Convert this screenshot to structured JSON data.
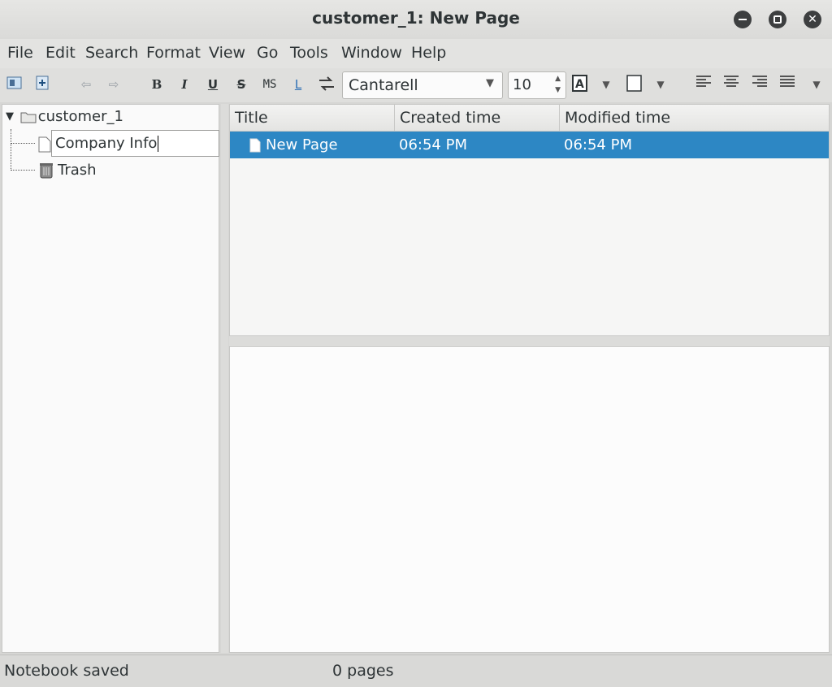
{
  "window": {
    "title": "customer_1: New Page"
  },
  "menubar": {
    "items": [
      "File",
      "Edit",
      "Search",
      "Format",
      "View",
      "Go",
      "Tools",
      "Window",
      "Help"
    ]
  },
  "toolbar": {
    "bold": "B",
    "italic": "I",
    "underline": "U",
    "strike": "S",
    "mono": "MS",
    "link": "L",
    "font_family": "Cantarell",
    "font_size": "10"
  },
  "tree": {
    "notebook": "customer_1",
    "editing_page": "Company Info",
    "trash": "Trash"
  },
  "page_list": {
    "columns": [
      "Title",
      "Created time",
      "Modified time"
    ],
    "rows": [
      {
        "title": "New Page",
        "created": "06:54 PM",
        "modified": "06:54 PM"
      }
    ]
  },
  "status": {
    "left": "Notebook saved",
    "pages": "0 pages"
  },
  "colors": {
    "selection": "#2d87c4",
    "window_bg": "#d6d6d4"
  }
}
